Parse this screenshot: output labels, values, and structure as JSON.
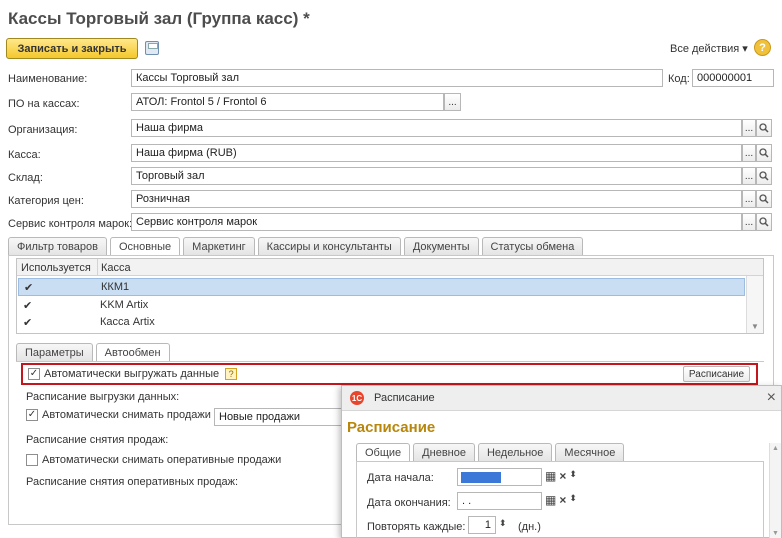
{
  "window": {
    "title": "Кассы Торговый зал (Группа касс) *"
  },
  "toolbar": {
    "save_close": "Записать и закрыть",
    "all_actions": "Все действия ▾",
    "help": "?"
  },
  "form": {
    "name_label": "Наименование:",
    "name_value": "Кассы Торговый зал",
    "code_label": "Код:",
    "code_value": "000000001",
    "po_label": "ПО на кассах:",
    "po_value": "АТОЛ: Frontol 5 / Frontol 6",
    "org_label": "Организация:",
    "org_value": "Наша фирма",
    "kassa_label": "Касса:",
    "kassa_value": "Наша фирма (RUB)",
    "sklad_label": "Склад:",
    "sklad_value": "Торговый зал",
    "price_label": "Категория цен:",
    "price_value": "Розничная",
    "service_label": "Сервис контроля марок:",
    "service_value": "Сервис контроля марок",
    "ellipsis": "...",
    "search_glyph": "🔍"
  },
  "tabs": [
    "Фильтр товаров",
    "Основные",
    "Маркетинг",
    "Кассиры и консультанты",
    "Документы",
    "Статусы обмена"
  ],
  "table": {
    "headers": [
      "Используется",
      "Касса"
    ],
    "rows": [
      {
        "check": "✔",
        "name": "ККМ1"
      },
      {
        "check": "✔",
        "name": "KKM Artix"
      },
      {
        "check": "✔",
        "name": "Касса Artix"
      }
    ]
  },
  "subtabs": [
    "Параметры",
    "Автообмен"
  ],
  "autoexchange": {
    "auto_upload": "Автоматически выгружать данные",
    "help": "?",
    "schedule_btn": "Расписание",
    "upload_sched": "Расписание выгрузки данных:",
    "auto_sales": "Автоматически снимать продажи",
    "sales_value": "Новые продажи",
    "sales_sched": "Расписание снятия продаж:",
    "auto_oper": "Автоматически снимать оперативные продажи",
    "oper_sched": "Расписание снятия оперативных продаж:"
  },
  "popup": {
    "window_title": "Расписание",
    "close": "×",
    "heading": "Расписание",
    "tabs": [
      "Общие",
      "Дневное",
      "Недельное",
      "Месячное"
    ],
    "start_label": "Дата начала:",
    "start_value": "",
    "end_label": "Дата окончания:",
    "end_value": " .  .",
    "repeat_label": "Повторять каждые:",
    "repeat_value": "1",
    "repeat_unit": "(дн.)"
  }
}
